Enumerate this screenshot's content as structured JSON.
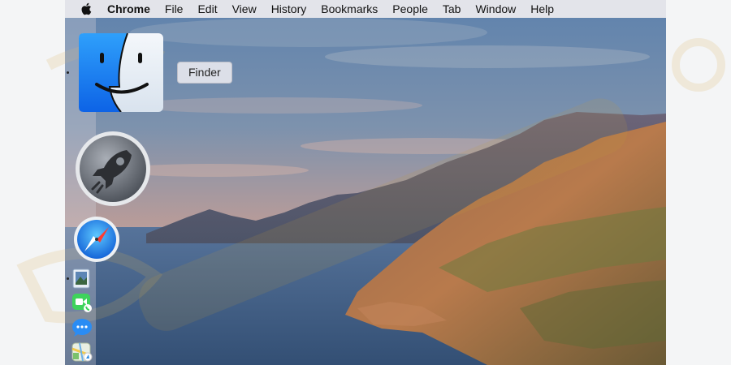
{
  "menubar": {
    "apple_icon": "apple-logo-icon",
    "app_name": "Chrome",
    "items": [
      "File",
      "Edit",
      "View",
      "History",
      "Bookmarks",
      "People",
      "Tab",
      "Window",
      "Help"
    ]
  },
  "dock": {
    "tooltip": "Finder",
    "icons": [
      {
        "name": "finder-icon",
        "label": "Finder"
      },
      {
        "name": "launchpad-icon",
        "label": "Launchpad"
      },
      {
        "name": "safari-icon",
        "label": "Safari"
      },
      {
        "name": "preview-icon",
        "label": "Preview"
      },
      {
        "name": "facetime-icon",
        "label": "FaceTime"
      },
      {
        "name": "messages-icon",
        "label": "Messages"
      },
      {
        "name": "maps-icon",
        "label": "Maps"
      }
    ]
  },
  "colors": {
    "menubar": "#e8e8ec",
    "finder_blue": "#1e7ef0",
    "sky_top": "#6d8eb6",
    "sea": "#3e5e84"
  }
}
